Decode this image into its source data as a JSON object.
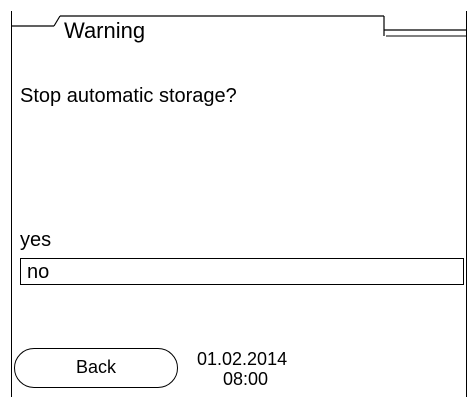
{
  "dialog": {
    "title": "Warning",
    "message": "Stop automatic storage?",
    "options": [
      "yes",
      "no"
    ],
    "selected_option": "no"
  },
  "softkeys": {
    "back_label": "Back"
  },
  "status": {
    "date": "01.02.2014",
    "time": "08:00"
  }
}
